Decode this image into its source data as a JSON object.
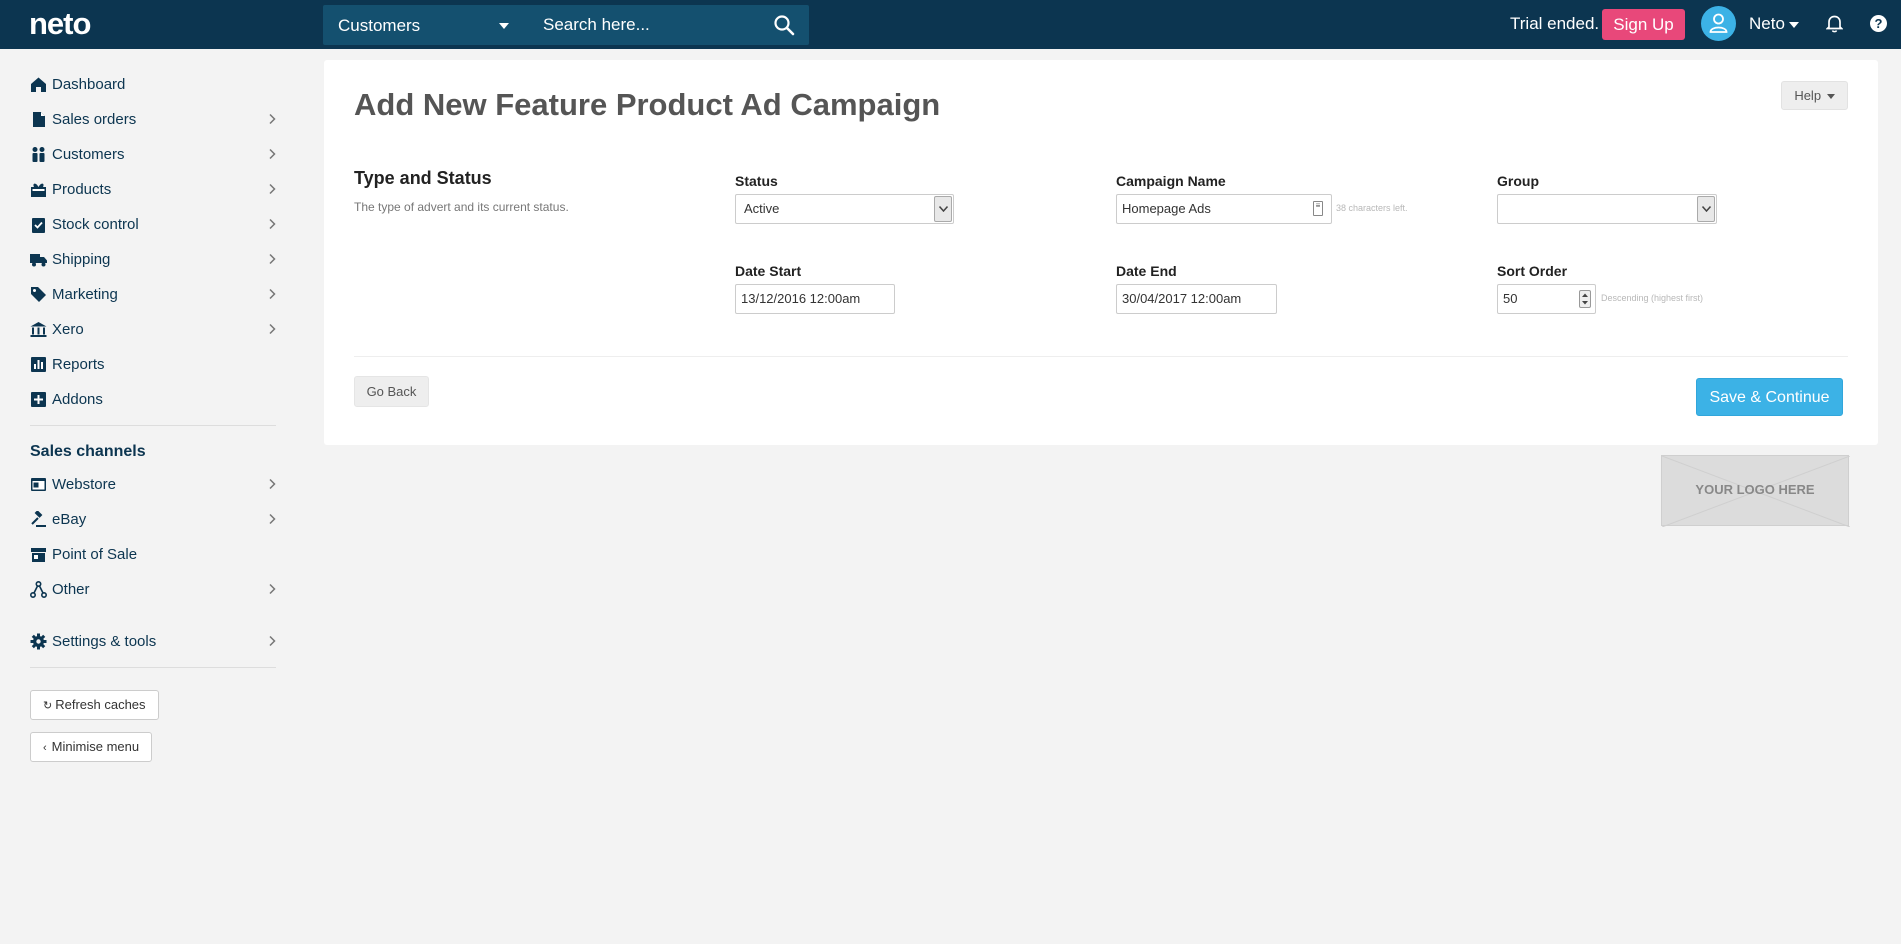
{
  "topbar": {
    "logo": "neto",
    "search_category": "Customers",
    "search_placeholder": "Search here...",
    "trial_text": "Trial ended.",
    "signup_label": "Sign Up",
    "user_name": "Neto"
  },
  "sidebar": {
    "items": [
      {
        "label": "Dashboard",
        "icon": "home-icon",
        "chevron": false
      },
      {
        "label": "Sales orders",
        "icon": "document-icon",
        "chevron": true
      },
      {
        "label": "Customers",
        "icon": "people-icon",
        "chevron": true
      },
      {
        "label": "Products",
        "icon": "gift-icon",
        "chevron": true
      },
      {
        "label": "Stock control",
        "icon": "clipboard-icon",
        "chevron": true
      },
      {
        "label": "Shipping",
        "icon": "truck-icon",
        "chevron": true
      },
      {
        "label": "Marketing",
        "icon": "tag-icon",
        "chevron": true
      },
      {
        "label": "Xero",
        "icon": "bank-icon",
        "chevron": true
      },
      {
        "label": "Reports",
        "icon": "chart-icon",
        "chevron": false
      },
      {
        "label": "Addons",
        "icon": "plus-square-icon",
        "chevron": false
      }
    ],
    "channels_title": "Sales channels",
    "channels": [
      {
        "label": "Webstore",
        "icon": "browser-icon",
        "chevron": true
      },
      {
        "label": "eBay",
        "icon": "gavel-icon",
        "chevron": true
      },
      {
        "label": "Point of Sale",
        "icon": "store-icon",
        "chevron": false
      },
      {
        "label": "Other",
        "icon": "network-icon",
        "chevron": true
      }
    ],
    "settings": {
      "label": "Settings & tools",
      "icon": "gear-icon",
      "chevron": true
    },
    "refresh_label": "Refresh caches",
    "minimise_label": "Minimise menu"
  },
  "main": {
    "title": "Add New Feature Product Ad Campaign",
    "help_label": "Help",
    "section_title": "Type and Status",
    "section_desc": "The type of advert and its current status.",
    "fields": {
      "status": {
        "label": "Status",
        "value": "Active"
      },
      "campaign_name": {
        "label": "Campaign Name",
        "value": "Homepage Ads",
        "hint": "38 characters left."
      },
      "group": {
        "label": "Group",
        "value": ""
      },
      "date_start": {
        "label": "Date Start",
        "value": "13/12/2016 12:00am"
      },
      "date_end": {
        "label": "Date End",
        "value": "30/04/2017 12:00am"
      },
      "sort_order": {
        "label": "Sort Order",
        "value": "50",
        "hint": "Descending (highest first)"
      }
    },
    "go_back_label": "Go Back",
    "save_label": "Save & Continue",
    "logo_placeholder": "YOUR LOGO HERE"
  },
  "colors": {
    "topbar": "#0c3550",
    "accent": "#3cb2e6",
    "signup": "#e8487a"
  }
}
